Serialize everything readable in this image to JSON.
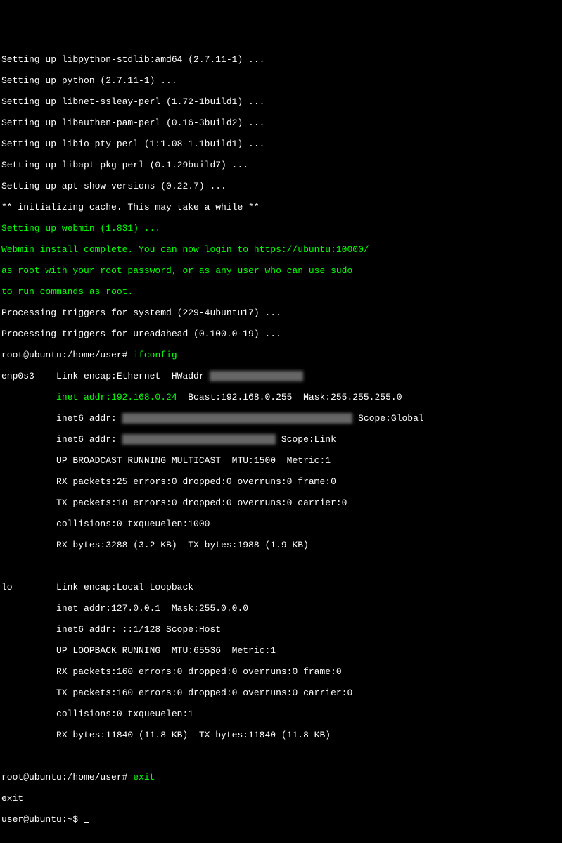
{
  "lines": {
    "l1": "Setting up libpython-stdlib:amd64 (2.7.11-1) ...",
    "l2": "Setting up python (2.7.11-1) ...",
    "l3": "Setting up libnet-ssleay-perl (1.72-1build1) ...",
    "l4": "Setting up libauthen-pam-perl (0.16-3build2) ...",
    "l5": "Setting up libio-pty-perl (1:1.08-1.1build1) ...",
    "l6": "Setting up libapt-pkg-perl (0.1.29build7) ...",
    "l7": "Setting up apt-show-versions (0.22.7) ...",
    "l8": "** initializing cache. This may take a while **",
    "l9": "Setting up webmin (1.831) ...",
    "l10": "Webmin install complete. You can now login to https://ubuntu:10000/",
    "l11": "as root with your root password, or as any user who can use sudo",
    "l12": "to run commands as root.",
    "l13": "Processing triggers for systemd (229-4ubuntu17) ...",
    "l14": "Processing triggers for ureadahead (0.100.0-19) ...",
    "prompt1_text": "root@ubuntu:/home/user# ",
    "cmd1": "ifconfig",
    "iface1_label": "enp0s3    Link encap:Ethernet  HWaddr ",
    "iface1_hwaddr_redacted": "██:██:██:██:██:██",
    "iface1_inet": "          inet addr:192.168.0.24",
    "iface1_inet_rest": "  Bcast:192.168.0.255  Mask:255.255.255.0",
    "iface1_inet6a_pre": "          inet6 addr: ",
    "iface1_inet6a_redacted": "████:████:████:████:████:████:████:████/64",
    "iface1_inet6a_post": " Scope:Global",
    "iface1_inet6b_pre": "          inet6 addr: ",
    "iface1_inet6b_redacted": "████::████:████:████:████/64",
    "iface1_inet6b_post": " Scope:Link",
    "iface1_up": "          UP BROADCAST RUNNING MULTICAST  MTU:1500  Metric:1",
    "iface1_rx": "          RX packets:25 errors:0 dropped:0 overruns:0 frame:0",
    "iface1_tx": "          TX packets:18 errors:0 dropped:0 overruns:0 carrier:0",
    "iface1_col": "          collisions:0 txqueuelen:1000",
    "iface1_bytes": "          RX bytes:3288 (3.2 KB)  TX bytes:1988 (1.9 KB)",
    "blank": " ",
    "iface2_label": "lo        Link encap:Local Loopback",
    "iface2_inet": "          inet addr:127.0.0.1  Mask:255.0.0.0",
    "iface2_inet6": "          inet6 addr: ::1/128 Scope:Host",
    "iface2_up": "          UP LOOPBACK RUNNING  MTU:65536  Metric:1",
    "iface2_rx": "          RX packets:160 errors:0 dropped:0 overruns:0 frame:0",
    "iface2_tx": "          TX packets:160 errors:0 dropped:0 overruns:0 carrier:0",
    "iface2_col": "          collisions:0 txqueuelen:1",
    "iface2_bytes": "          RX bytes:11840 (11.8 KB)  TX bytes:11840 (11.8 KB)",
    "prompt2_text": "root@ubuntu:/home/user# ",
    "cmd2": "exit",
    "exit_echo": "exit",
    "prompt3_text": "user@ubuntu:~$ "
  }
}
